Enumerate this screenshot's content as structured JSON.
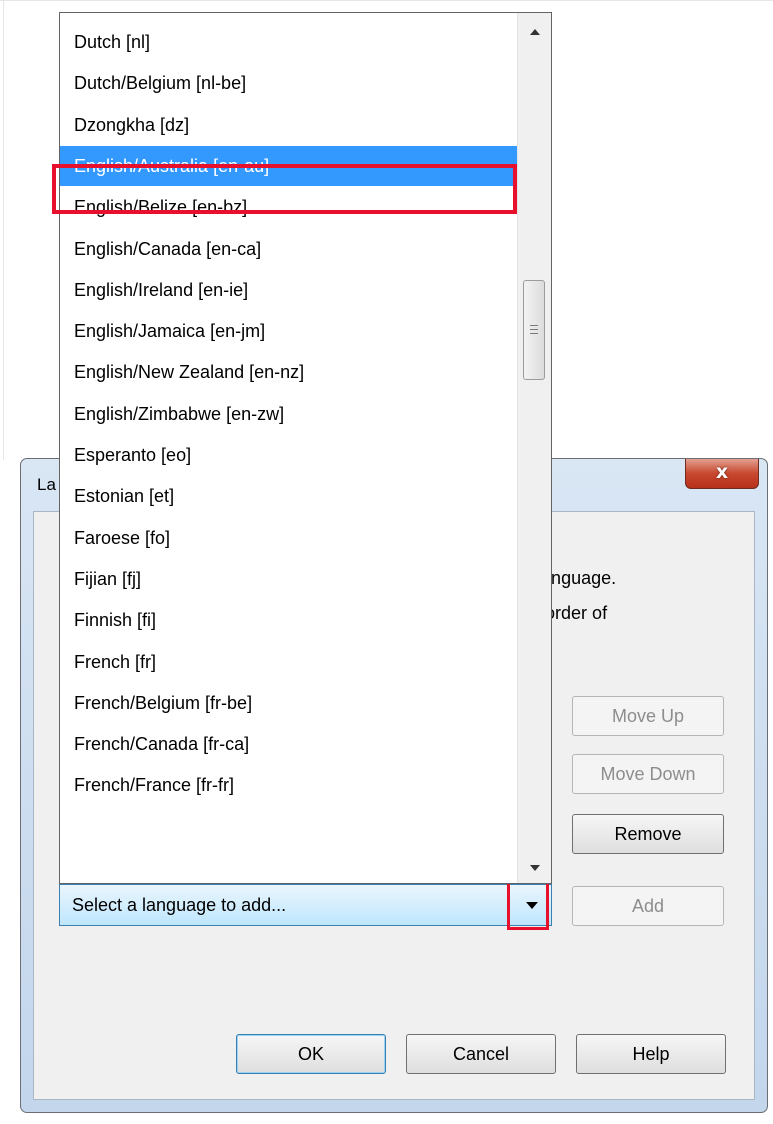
{
  "dialog": {
    "title_partial": "La",
    "close_glyph": "x",
    "description_lines": [
      "n one language.",
      "ges, in order of"
    ],
    "buttons": {
      "move_up": "Move Up",
      "move_down": "Move Down",
      "remove": "Remove",
      "add": "Add",
      "ok": "OK",
      "cancel": "Cancel",
      "help": "Help"
    }
  },
  "language_combo": {
    "placeholder": "Select a language to add...",
    "items": [
      {
        "label": "Dutch  [nl]",
        "selected": false
      },
      {
        "label": "Dutch/Belgium  [nl-be]",
        "selected": false
      },
      {
        "label": "Dzongkha  [dz]",
        "selected": false
      },
      {
        "label": "English/Australia  [en-au]",
        "selected": true
      },
      {
        "label": "English/Belize  [en-bz]",
        "selected": false
      },
      {
        "label": "English/Canada  [en-ca]",
        "selected": false
      },
      {
        "label": "English/Ireland  [en-ie]",
        "selected": false
      },
      {
        "label": "English/Jamaica  [en-jm]",
        "selected": false
      },
      {
        "label": "English/New Zealand  [en-nz]",
        "selected": false
      },
      {
        "label": "English/Zimbabwe  [en-zw]",
        "selected": false
      },
      {
        "label": "Esperanto  [eo]",
        "selected": false
      },
      {
        "label": "Estonian  [et]",
        "selected": false
      },
      {
        "label": "Faroese  [fo]",
        "selected": false
      },
      {
        "label": "Fijian  [fj]",
        "selected": false
      },
      {
        "label": "Finnish  [fi]",
        "selected": false
      },
      {
        "label": "French  [fr]",
        "selected": false
      },
      {
        "label": "French/Belgium  [fr-be]",
        "selected": false
      },
      {
        "label": "French/Canada  [fr-ca]",
        "selected": false
      },
      {
        "label": "French/France  [fr-fr]",
        "selected": false
      }
    ]
  },
  "colors": {
    "selection": "#3399ff",
    "highlight_box": "#e8112d"
  }
}
